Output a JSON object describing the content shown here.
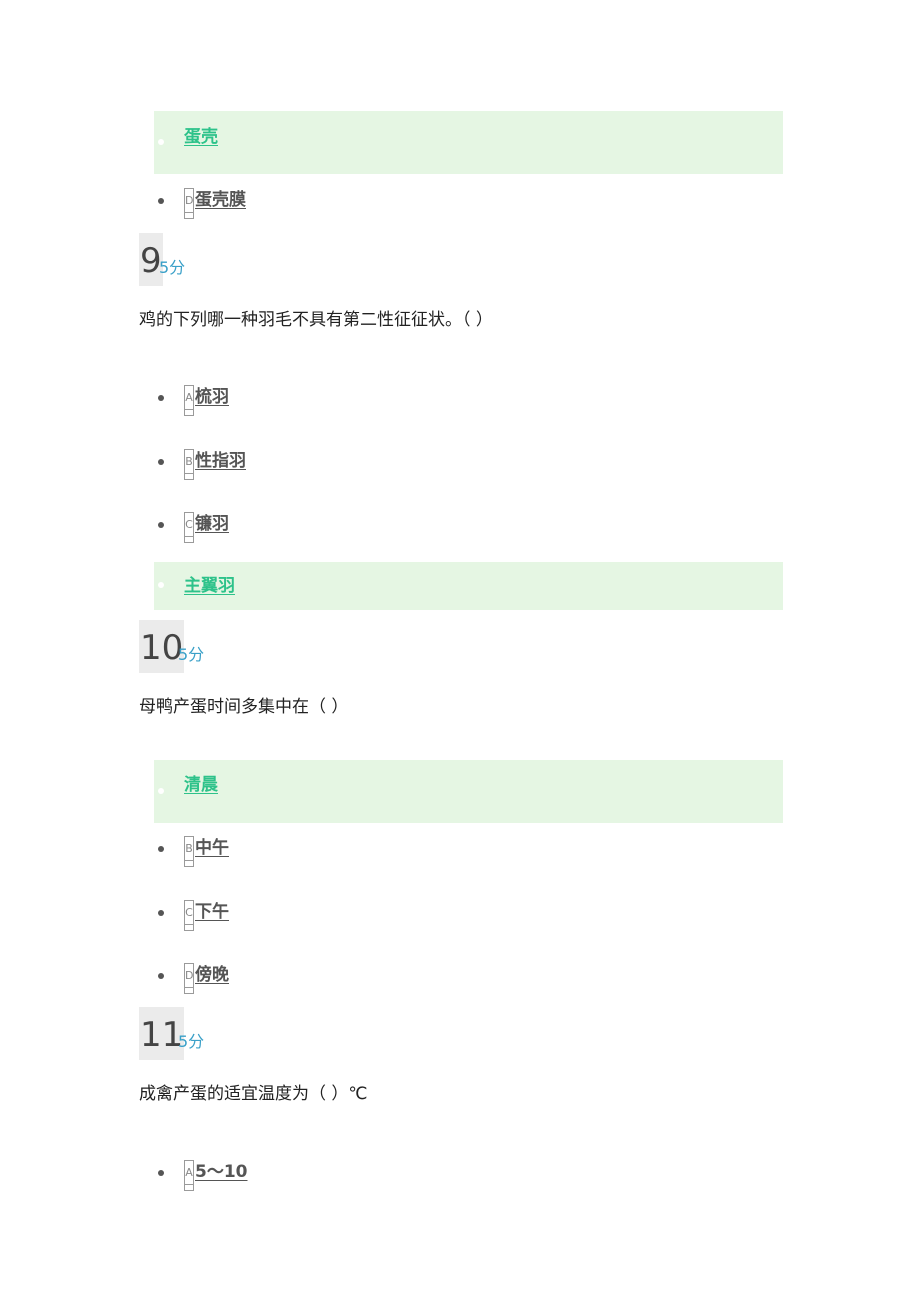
{
  "colors": {
    "correct_bg": "#e5f6e3",
    "correct_text": "#2dc28a",
    "score_text": "#3aa0c8",
    "qnum_bg": "#ebebeb"
  },
  "top_options": [
    {
      "letter": "",
      "text": "蛋壳",
      "correct": true
    },
    {
      "letter": "D",
      "text": "蛋壳膜",
      "correct": false
    }
  ],
  "questions": [
    {
      "number": "9",
      "score": "5分",
      "text": "鸡的下列哪一种羽毛不具有第二性征征状。（    ）",
      "options": [
        {
          "letter": "A",
          "text": "梳羽",
          "correct": false
        },
        {
          "letter": "B",
          "text": "性指羽",
          "correct": false
        },
        {
          "letter": "C",
          "text": "镰羽",
          "correct": false
        },
        {
          "letter": "",
          "text": "主翼羽",
          "correct": true
        }
      ]
    },
    {
      "number": "10",
      "score": "5分",
      "text": "母鸭产蛋时间多集中在（    ）",
      "options": [
        {
          "letter": "",
          "text": "清晨",
          "correct": true
        },
        {
          "letter": "B",
          "text": "中午",
          "correct": false
        },
        {
          "letter": "C",
          "text": "下午",
          "correct": false
        },
        {
          "letter": "D",
          "text": "傍晚",
          "correct": false
        }
      ]
    },
    {
      "number": "11",
      "score": "5分",
      "text": "成禽产蛋的适宜温度为（    ）℃",
      "options": [
        {
          "letter": "A",
          "text": "5～10",
          "correct": false
        }
      ]
    }
  ]
}
